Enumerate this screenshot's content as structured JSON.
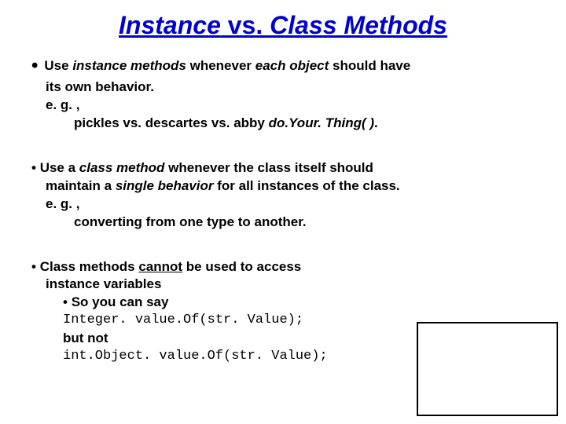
{
  "title_part1": "Instance",
  "title_vs": " vs. ",
  "title_part2": "Class Methods",
  "b1": {
    "pre": "Use ",
    "im": "instance methods",
    "mid": " whenever ",
    "eo": "each object",
    "post": " should have",
    "line2": "its own behavior.",
    "eg": "e. g. ,",
    "ex_pre": "pickles vs. descartes vs. abby ",
    "ex_ital": "do.Your. Thing( )",
    "ex_dot": "."
  },
  "b2": {
    "pre": "Use a ",
    "cm": "class method",
    "mid": " whenever the class itself should",
    "line2a": "maintain a ",
    "sb": "single behavior",
    "line2b": " for all instances of the class.",
    "eg": "e. g. ,",
    "ex": "converting from one type to another."
  },
  "b3": {
    "pre": "Class methods ",
    "cannot": "cannot",
    "post": " be used to access",
    "line2": "instance variables",
    "so": "So you can say",
    "code1": "Integer. value.Of(str. Value);",
    "butnot": "but not",
    "code2": "int.Object. value.Of(str. Value);"
  }
}
